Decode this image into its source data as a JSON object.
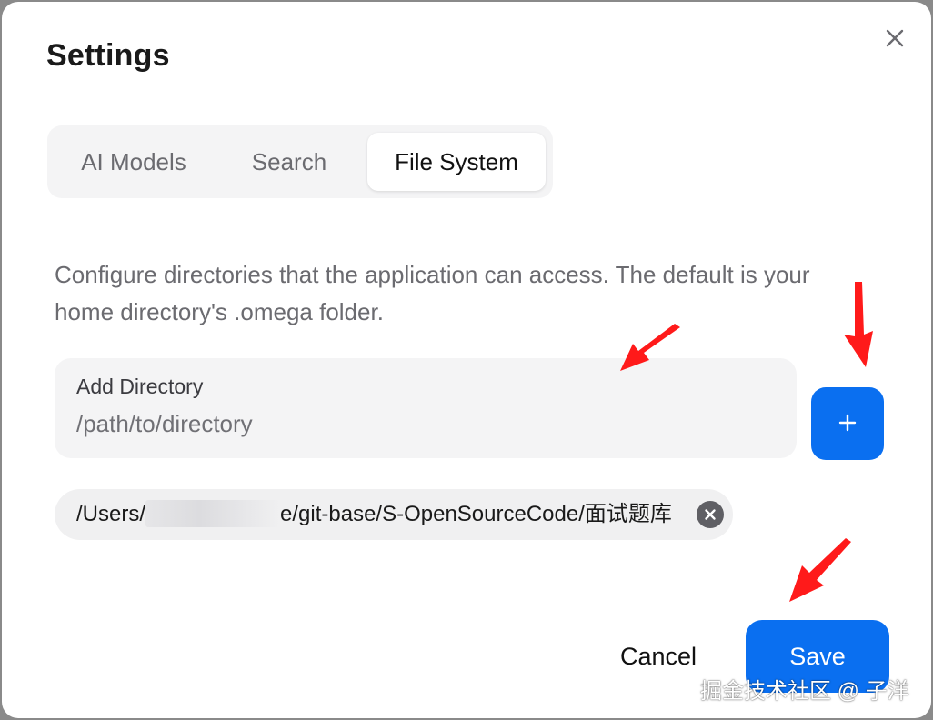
{
  "dialog": {
    "title": "Settings",
    "close_icon": "close-icon"
  },
  "tabs": [
    {
      "label": "AI Models",
      "active": false
    },
    {
      "label": "Search",
      "active": false
    },
    {
      "label": "File System",
      "active": true
    }
  ],
  "file_system": {
    "description": "Configure directories that the application can access. The default is your home directory's .omega folder.",
    "add_directory": {
      "label": "Add Directory",
      "value": "",
      "placeholder": "/path/to/directory",
      "add_button_icon": "plus-icon",
      "add_button_label": "+"
    },
    "directories": [
      {
        "path_prefix": "/Users/",
        "path_suffix": "e/git-base/S-OpenSourceCode/面试题库",
        "remove_icon": "close-circle-icon"
      }
    ]
  },
  "footer": {
    "cancel_label": "Cancel",
    "save_label": "Save"
  },
  "watermark": "掘金技术社区 @ 子洋",
  "colors": {
    "accent": "#0a6ff0",
    "annotation_arrow": "#ff1a1a",
    "muted_text": "#6b6b70"
  }
}
